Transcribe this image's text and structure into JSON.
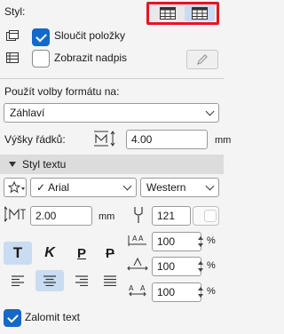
{
  "style": {
    "label": "Styl:",
    "merge_items_label": "Sloučit položky",
    "merge_items_checked": true,
    "show_heading_label": "Zobrazit nadpis",
    "show_heading_checked": false
  },
  "format": {
    "label": "Použít volby formátu na:",
    "target_value": "Záhlaví"
  },
  "row_height": {
    "label": "Výšky řádků:",
    "value": "4.00",
    "unit": "mm"
  },
  "text_style": {
    "section_label": "Styl textu",
    "font_value": "Arial",
    "script_value": "Western",
    "size_value": "2.00",
    "size_unit": "mm",
    "pen_value": "121",
    "spacing": [
      {
        "value": "100",
        "unit": "%"
      },
      {
        "value": "100",
        "unit": "%"
      },
      {
        "value": "100",
        "unit": "%"
      }
    ],
    "bold_glyph": "T",
    "italic_glyph": "K",
    "underline_glyph": "P",
    "strike_glyph": "P"
  },
  "wrap": {
    "label": "Zalomit text",
    "checked": true
  },
  "colors": {
    "accent": "#1468c7",
    "highlight_border": "#e8141c",
    "selected_bg": "#c9dcf2"
  }
}
